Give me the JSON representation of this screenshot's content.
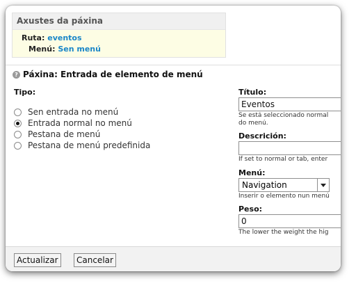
{
  "settings": {
    "title": "Axustes da páxina",
    "route_label": "Ruta:",
    "route_value": "eventos",
    "menu_label": "Menú:",
    "menu_value": "Sen menú"
  },
  "section": {
    "title": "Páxina: Entrada de elemento de menú"
  },
  "type": {
    "label": "Tipo:",
    "options": [
      {
        "label": "Sen entrada no menú",
        "checked": false
      },
      {
        "label": "Entrada normal no menú",
        "checked": true
      },
      {
        "label": "Pestana de menú",
        "checked": false
      },
      {
        "label": "Pestana de menú predefinida",
        "checked": false
      }
    ]
  },
  "title_field": {
    "label": "Título:",
    "value": "Eventos",
    "hint_line1": "Se está seleccionado normal",
    "hint_line2": "do menú."
  },
  "description_field": {
    "label": "Descrición:",
    "value": "",
    "hint": "If set to normal or tab, enter"
  },
  "menu_field": {
    "label": "Menú:",
    "value": "Navigation",
    "hint": "Inserir o elemento nun menú"
  },
  "weight_field": {
    "label": "Peso:",
    "value": "0",
    "hint": "The lower the weight the hig"
  },
  "buttons": {
    "update": "Actualizar",
    "cancel": "Cancelar"
  }
}
